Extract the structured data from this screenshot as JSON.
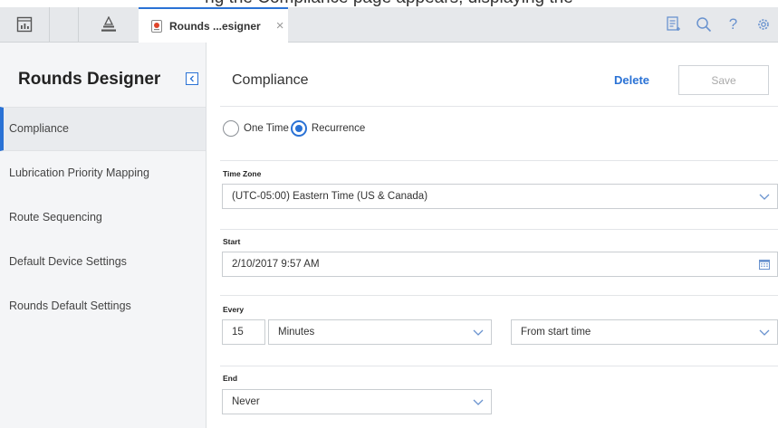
{
  "page": {
    "partial_heading": "ng the Compliance page appears, displaying the"
  },
  "toolbar": {
    "icons": [
      "dashboard-icon",
      "hierarchy-icon",
      "checklist-icon",
      "search-icon",
      "help-icon",
      "settings-icon"
    ],
    "tab_label": "Rounds ...esigner",
    "tab_close": "×",
    "help_glyph": "?"
  },
  "sidebar": {
    "title": "Rounds Designer",
    "items": [
      {
        "label": "Compliance",
        "active": true
      },
      {
        "label": "Lubrication Priority Mapping"
      },
      {
        "label": "Route Sequencing"
      },
      {
        "label": "Default Device Settings"
      },
      {
        "label": "Rounds Default Settings"
      }
    ]
  },
  "main": {
    "title": "Compliance",
    "delete_label": "Delete",
    "save_label": "Save",
    "schedule": {
      "options": [
        "One Time",
        "Recurrence"
      ],
      "selected": "Recurrence"
    },
    "time_zone": {
      "label": "Time Zone",
      "value": "(UTC-05:00) Eastern Time (US & Canada)"
    },
    "start": {
      "label": "Start",
      "value": "2/10/2017 9:57 AM"
    },
    "every": {
      "label": "Every",
      "quantity": "15",
      "unit": "Minutes",
      "basis": "From start time"
    },
    "end": {
      "label": "End",
      "value": "Never"
    }
  },
  "colors": {
    "accent": "#2a72d5",
    "topbar": "#e6e8eb",
    "sidebar": "#f4f5f7"
  }
}
